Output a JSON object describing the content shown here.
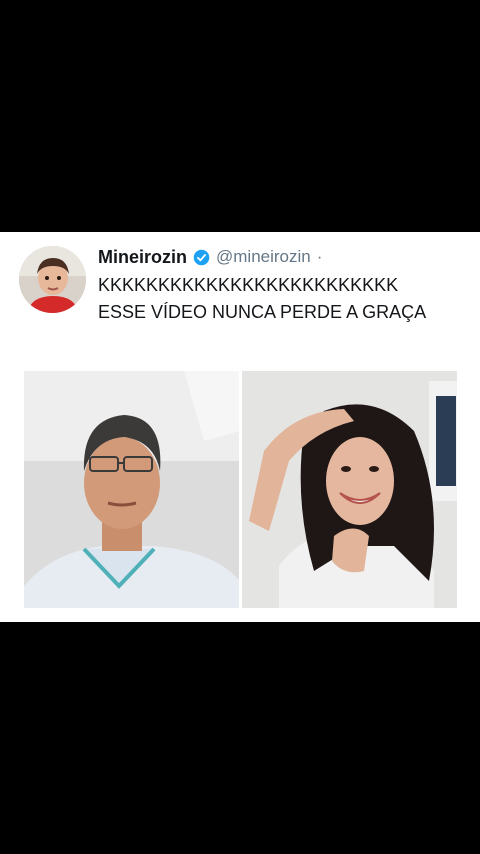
{
  "tweet": {
    "display_name": "Mineirozin",
    "handle": "@mineirozin",
    "separator": "·",
    "text_line_1": "KKKKKKKKKKKKKKKKKKKKKKKKK",
    "text_line_2": "ESSE VÍDEO NUNCA PERDE A GRAÇA"
  },
  "icons": {
    "verified": "verified-badge-icon"
  },
  "colors": {
    "verified_blue": "#1da1f2",
    "name_text": "#14171a",
    "handle_text": "#657786"
  }
}
